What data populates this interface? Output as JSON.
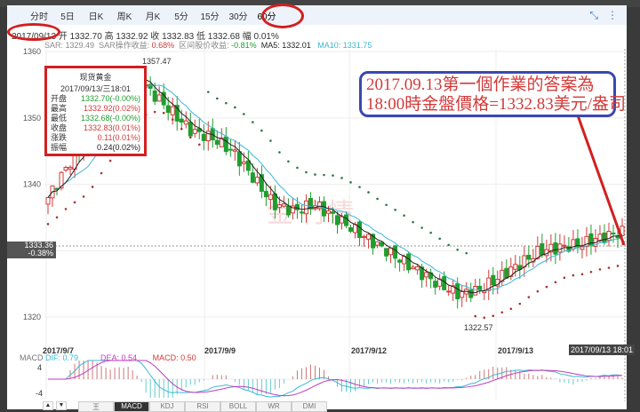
{
  "tabs": [
    "分时",
    "5日",
    "日K",
    "周K",
    "月K",
    "5分",
    "15分",
    "30分",
    "60分"
  ],
  "active_tab": "60分",
  "ohlc_line": {
    "date": "2017/09/13",
    "open_label": "开",
    "open": "1332.70",
    "high_label": "高",
    "high": "1332.92",
    "close_label": "收",
    "close": "1332.83",
    "low_label": "低",
    "low": "1332.68",
    "change_label": "幅",
    "change": "0.01%"
  },
  "indicators": {
    "sar": "SAR: 1329.49",
    "sar_ret_label": "SAR操作收益:",
    "sar_ret": "0.68%",
    "range_label": "区间股价收益:",
    "range_ret": "-0.81%",
    "ma5": "MA5: 1332.01",
    "ma10": "MA10: 1331.75"
  },
  "tooltip": {
    "title": "现货黄金",
    "datetime": "2017/09/13/三18:01",
    "rows": [
      {
        "label": "开盘",
        "value": "1332.70(-0.00%)",
        "color": "green"
      },
      {
        "label": "最高",
        "value": "1332.92(0.02%)",
        "color": "red"
      },
      {
        "label": "最低",
        "value": "1332.68(-0.00%)",
        "color": "green"
      },
      {
        "label": "收盘",
        "value": "1332.83(0.01%)",
        "color": "red"
      },
      {
        "label": "涨跌",
        "value": "0.11(0.01%)",
        "color": "red"
      },
      {
        "label": "振幅",
        "value": "0.24(0.02%)",
        "color": "black"
      }
    ]
  },
  "callout": {
    "line1": "2017.09.13第一個作業的答案為",
    "line2": "18:00時金盤價格=1332.83美元/盎司"
  },
  "price_tag": {
    "price": "1333.36",
    "pct": "-0.38%"
  },
  "time_tag": "2017/09/13 18:01",
  "annotations": {
    "high": "1357.47",
    "low": "1322.57"
  },
  "y_ticks": [
    "1360",
    "1350",
    "1340",
    "1330",
    "1320"
  ],
  "dates": [
    "2017/9/7",
    "2017/9/9",
    "2017/9/12",
    "2017/9/13"
  ],
  "macd": {
    "label": "MACD",
    "dif": "DIF: 0.79",
    "dea": "DEA: 0.54",
    "macd": "MACD: 0.50",
    "ticks": [
      "4",
      "-4"
    ]
  },
  "bottom_tabs": [
    "王",
    "MACD",
    "KDJ",
    "RSI",
    "BOLL",
    "WR",
    "DMI"
  ],
  "colors": {
    "up": "#d23a3a",
    "down": "#1e9e2e",
    "ma5": "#222222",
    "ma10": "#3bb8d6",
    "sar_up": "#a33",
    "sar_dn": "#2a7a4a"
  },
  "chart_data": {
    "type": "candlestick",
    "y_range": [
      1320,
      1360
    ],
    "key_closes": [
      1338,
      1343,
      1347,
      1352,
      1357,
      1354,
      1351,
      1348,
      1347,
      1345,
      1341,
      1337,
      1336,
      1337,
      1335,
      1333,
      1331,
      1329,
      1327,
      1325,
      1323.5,
      1324,
      1326,
      1328,
      1330,
      1330.5,
      1331,
      1332,
      1332.8
    ]
  }
}
